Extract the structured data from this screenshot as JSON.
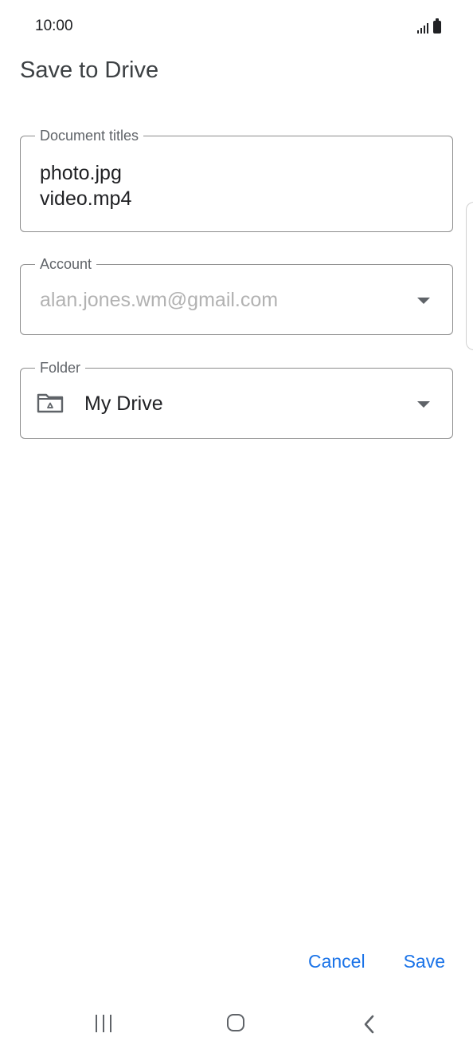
{
  "status_bar": {
    "time": "10:00",
    "icons": [
      "signal-icon",
      "battery-icon"
    ]
  },
  "dialog": {
    "title": "Save to Drive",
    "document_titles": {
      "label": "Document titles",
      "items": [
        "photo.jpg",
        "video.mp4"
      ]
    },
    "account": {
      "label": "Account",
      "value": "alan.jones.wm@gmail.com",
      "icon": "chevron-down-icon"
    },
    "folder": {
      "label": "Folder",
      "value": "My Drive",
      "icon": "drive-folder-icon"
    },
    "buttons": {
      "cancel": "Cancel",
      "save": "Save"
    }
  },
  "nav_bar": {
    "icons": [
      "recents-icon",
      "home-icon",
      "back-icon"
    ]
  },
  "colors": {
    "accent": "#1a73e8",
    "field_border": "#8c8c8c",
    "disabled_text": "#b2b2b2"
  }
}
